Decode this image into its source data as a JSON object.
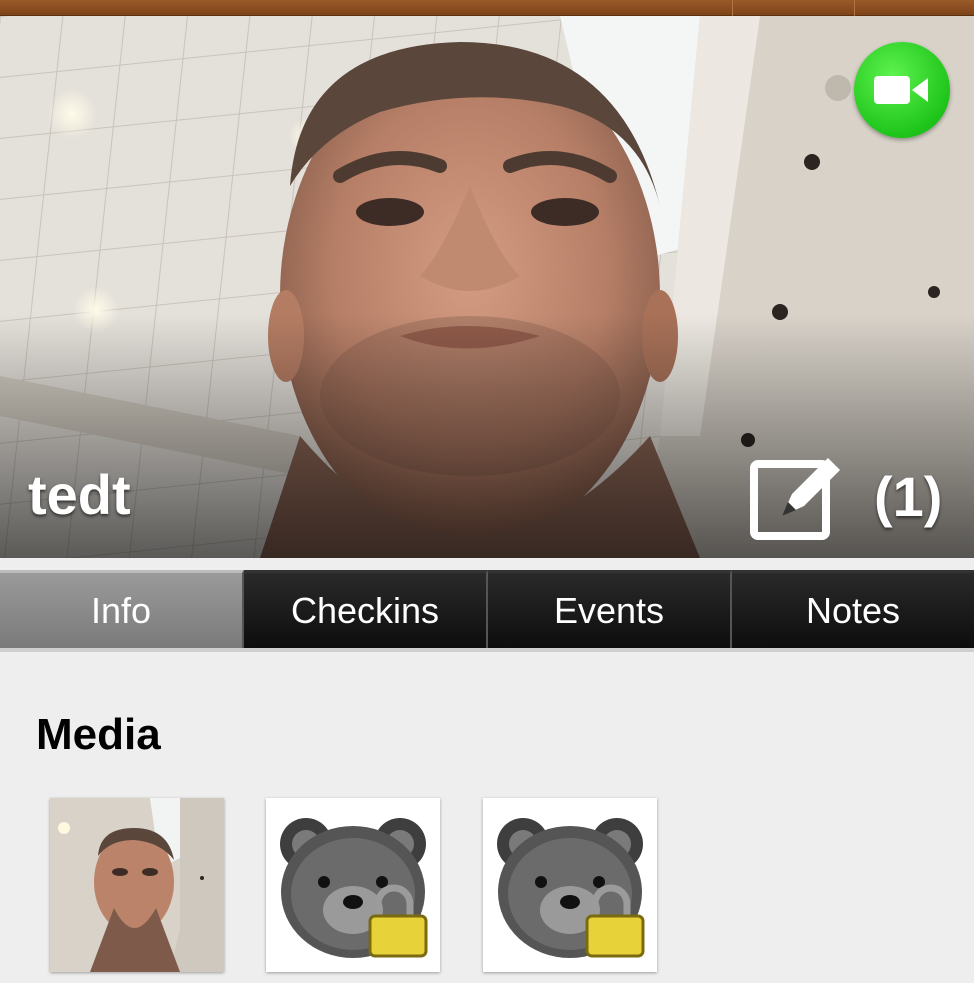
{
  "profile": {
    "name": "tedt",
    "edit_count": "(1)"
  },
  "icons": {
    "video_call": "video-camera-icon",
    "edit": "edit-icon",
    "locked_media": "bear-lock-icon"
  },
  "tabs": [
    {
      "label": "Info",
      "active": true
    },
    {
      "label": "Checkins",
      "active": false
    },
    {
      "label": "Events",
      "active": false
    },
    {
      "label": "Notes",
      "active": false
    }
  ],
  "media": {
    "title": "Media",
    "items": [
      {
        "kind": "photo"
      },
      {
        "kind": "locked"
      },
      {
        "kind": "locked"
      }
    ]
  },
  "colors": {
    "video_button": "#1fc51a",
    "top_bar": "#8b4d1f",
    "lock": "#e8d23a"
  }
}
